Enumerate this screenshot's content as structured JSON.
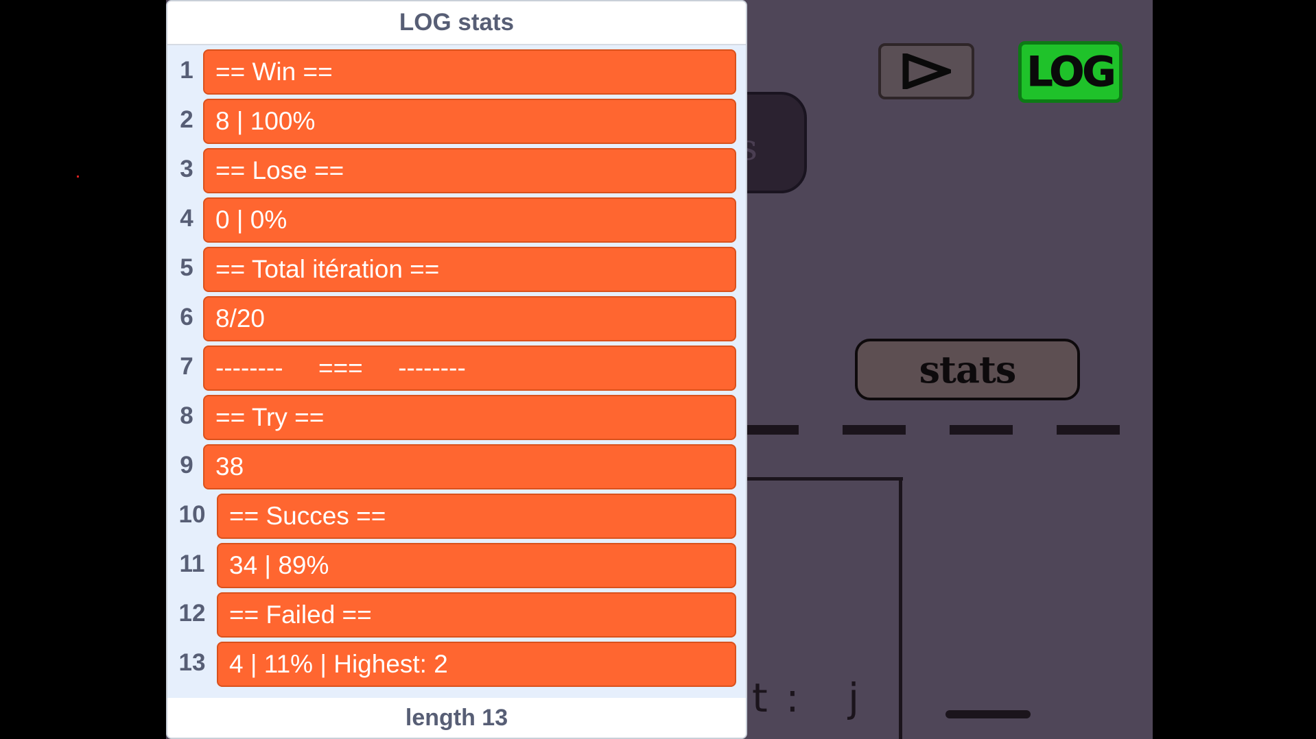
{
  "list": {
    "title": "LOG stats",
    "footer": "length 13",
    "items": [
      {
        "index": "1",
        "value": "== Win =="
      },
      {
        "index": "2",
        "value": "8 | 100%"
      },
      {
        "index": "3",
        "value": "== Lose =="
      },
      {
        "index": "4",
        "value": "0 | 0%"
      },
      {
        "index": "5",
        "value": "== Total itération =="
      },
      {
        "index": "6",
        "value": "8/20"
      },
      {
        "index": "7",
        "value": "--------     ===     --------"
      },
      {
        "index": "8",
        "value": "== Try =="
      },
      {
        "index": "9",
        "value": "38"
      },
      {
        "index": "10",
        "value": "== Succes =="
      },
      {
        "index": "11",
        "value": "34 | 89%"
      },
      {
        "index": "12",
        "value": "== Failed =="
      },
      {
        "index": "13",
        "value": "4 | 11% | Highest: 2"
      }
    ]
  },
  "game": {
    "log_button_label": "LOG",
    "stats_button_label": "stats",
    "play_icon": "play-triangle-icon",
    "partial_block_text": "s",
    "bottom_text": "t :   j"
  },
  "colors": {
    "stage_background": "#4f4658",
    "list_item": "#ff6630",
    "log_button": "#1fc22a",
    "list_background": "#e6effc"
  }
}
